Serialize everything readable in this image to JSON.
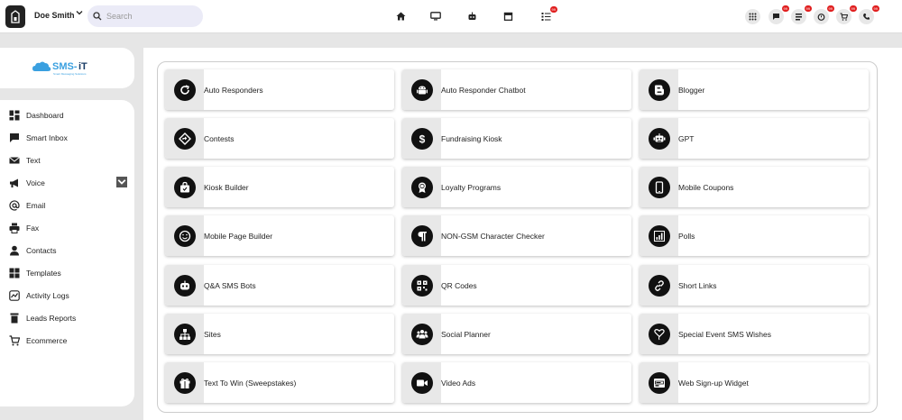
{
  "header": {
    "user_name": "Doe Smith",
    "search_placeholder": "Search",
    "nav_icons": [
      "home-icon",
      "monitor-icon",
      "robot-icon",
      "store-icon",
      "task-list-icon"
    ],
    "task_badge": "99",
    "right_icons": [
      {
        "name": "apps-grid-icon",
        "badge": ""
      },
      {
        "name": "messages-icon",
        "badge": "99"
      },
      {
        "name": "list-icon",
        "badge": "99"
      },
      {
        "name": "alarm-icon",
        "badge": "99"
      },
      {
        "name": "cart-icon",
        "badge": "99"
      },
      {
        "name": "phone-icon",
        "badge": "99"
      }
    ],
    "badge_color": "#e01e1e"
  },
  "sidebar": {
    "logo_text": "SMS-iT",
    "logo_tagline": "Smart Messaging Solutions",
    "brand_color": "#3aa0e0",
    "items": [
      {
        "label": "Dashboard",
        "icon": "dashboard-icon"
      },
      {
        "label": "Smart Inbox",
        "icon": "chat-icon"
      },
      {
        "label": "Text",
        "icon": "envelope-icon"
      },
      {
        "label": "Voice",
        "icon": "megaphone-icon"
      },
      {
        "label": "Email",
        "icon": "at-icon"
      },
      {
        "label": "Fax",
        "icon": "printer-icon"
      },
      {
        "label": "Contacts",
        "icon": "person-icon"
      },
      {
        "label": "Templates",
        "icon": "templates-icon"
      },
      {
        "label": "Activity Logs",
        "icon": "activity-icon"
      },
      {
        "label": "Leads Reports",
        "icon": "reports-icon"
      },
      {
        "label": "Ecommerce",
        "icon": "cart-icon"
      }
    ]
  },
  "tiles": [
    {
      "label": "Auto Responders",
      "icon": "refresh-icon"
    },
    {
      "label": "Auto Responder Chatbot",
      "icon": "android-icon"
    },
    {
      "label": "Blogger",
      "icon": "blogger-icon"
    },
    {
      "label": "Contests",
      "icon": "diamond-icon"
    },
    {
      "label": "Fundraising Kiosk",
      "icon": "dollar-icon"
    },
    {
      "label": "GPT",
      "icon": "robot-icon"
    },
    {
      "label": "Kiosk Builder",
      "icon": "bag-icon"
    },
    {
      "label": "Loyalty Programs",
      "icon": "award-icon"
    },
    {
      "label": "Mobile Coupons",
      "icon": "mobile-icon"
    },
    {
      "label": "Mobile Page Builder",
      "icon": "smiley-icon"
    },
    {
      "label": "NON-GSM Character Checker",
      "icon": "paragraph-icon"
    },
    {
      "label": "Polls",
      "icon": "poll-icon"
    },
    {
      "label": "Q&A SMS Bots",
      "icon": "bot-icon"
    },
    {
      "label": "QR Codes",
      "icon": "qr-icon"
    },
    {
      "label": "Short Links",
      "icon": "link-icon"
    },
    {
      "label": "Sites",
      "icon": "sitemap-icon"
    },
    {
      "label": "Social Planner",
      "icon": "people-icon"
    },
    {
      "label": "Special Event SMS Wishes",
      "icon": "heart-balloon-icon"
    },
    {
      "label": "Text To Win (Sweepstakes)",
      "icon": "gift-icon"
    },
    {
      "label": "Video Ads",
      "icon": "video-icon"
    },
    {
      "label": "Web Sign-up Widget",
      "icon": "widget-icon"
    }
  ]
}
